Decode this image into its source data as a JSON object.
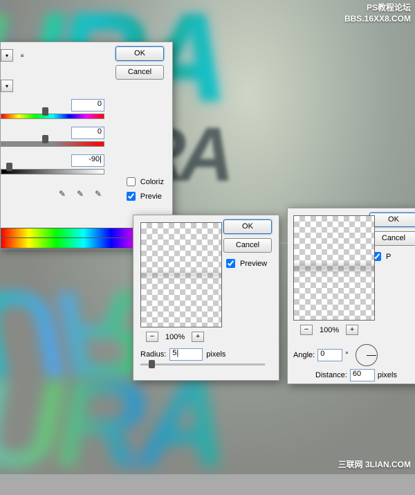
{
  "watermark": {
    "top_line1": "PS教程论坛",
    "top_line2": "BBS.16XX8.COM",
    "bottom": "三联网 3LIAN.COM"
  },
  "artwork_text": "URA",
  "hs": {
    "ok": "OK",
    "cancel": "Cancel",
    "colorize": "Coloriz",
    "preview": "Previe",
    "hue": "0",
    "sat": "0",
    "light": "-90|"
  },
  "gauss": {
    "ok": "OK",
    "cancel": "Cancel",
    "preview": "Preview",
    "zoom": "100%",
    "radius_label": "Radius:",
    "radius": "5|",
    "pixels": "pixels"
  },
  "motion": {
    "ok": "OK",
    "cancel": "Cancel",
    "preview": "P",
    "zoom": "100%",
    "angle_label": "Angle:",
    "angle": "0",
    "degree": "°",
    "distance_label": "Distance:",
    "distance": "60",
    "pixels": "pixels"
  }
}
